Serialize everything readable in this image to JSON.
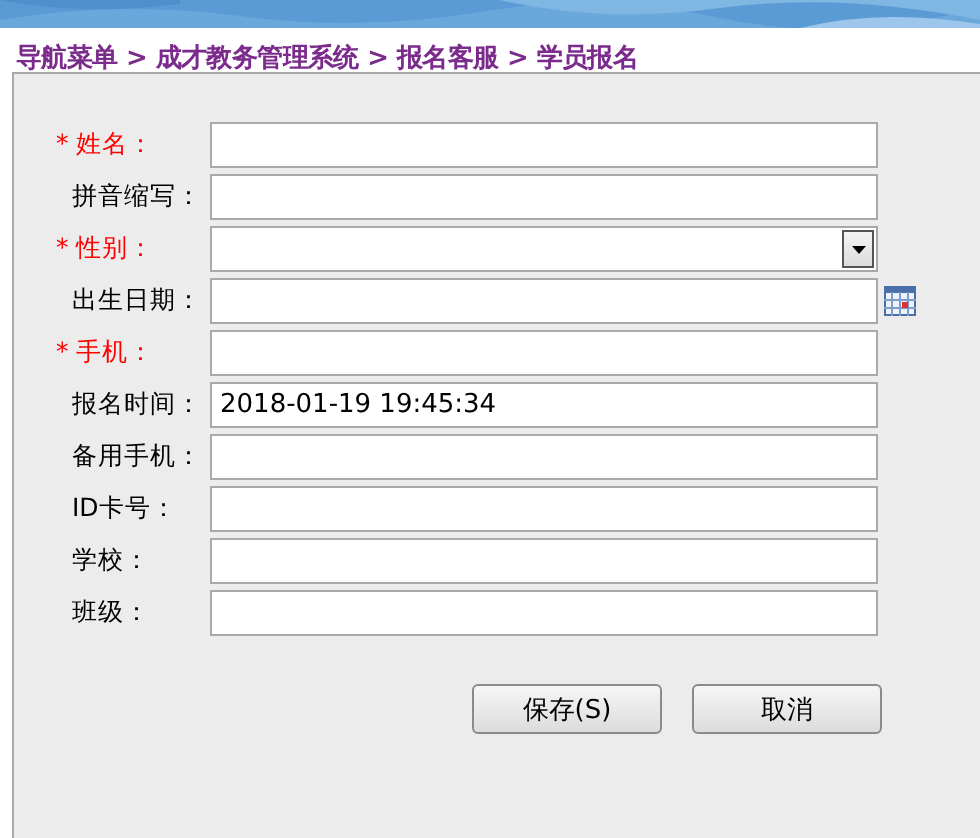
{
  "breadcrumb": "导航菜单 > 成才教务管理系统 > 报名客服 > 学员报名",
  "fields": [
    {
      "label": "* 姓名：",
      "required": true,
      "kind": "text"
    },
    {
      "label": "拼音缩写：",
      "required": false,
      "kind": "text"
    },
    {
      "label": "* 性别：",
      "required": true,
      "kind": "select"
    },
    {
      "label": "出生日期：",
      "required": false,
      "kind": "date"
    },
    {
      "label": "* 手机：",
      "required": true,
      "kind": "text"
    },
    {
      "label": "报名时间：",
      "required": false,
      "kind": "text",
      "value": "2018-01-19 19:45:34"
    },
    {
      "label": "备用手机：",
      "required": false,
      "kind": "text"
    },
    {
      "label": "ID卡号：",
      "required": false,
      "kind": "text"
    },
    {
      "label": "学校：",
      "required": false,
      "kind": "text"
    },
    {
      "label": "班级：",
      "required": false,
      "kind": "text"
    }
  ],
  "buttons": [
    "保存(S)",
    "取消"
  ]
}
